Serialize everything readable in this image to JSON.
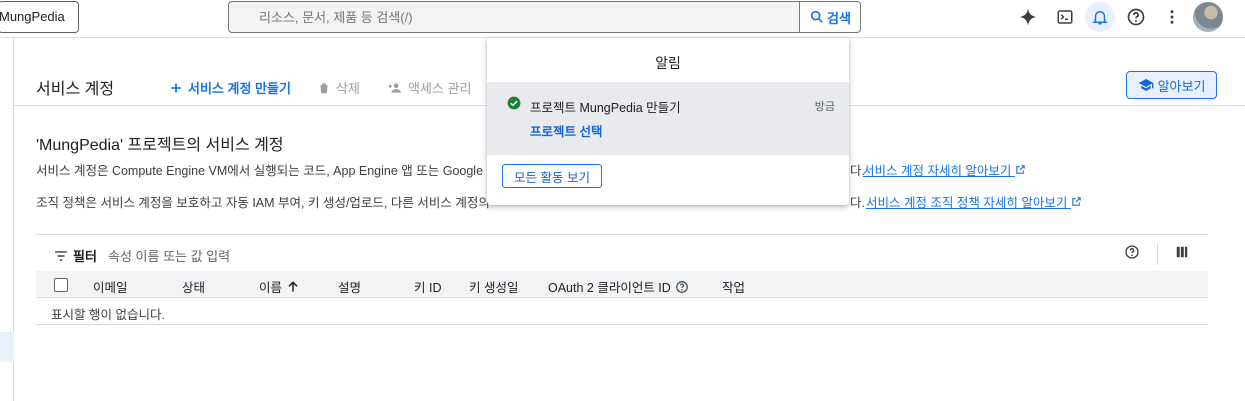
{
  "topbar": {
    "project_name": "MungPedia",
    "search_placeholder": "리소스, 문서, 제품 등 검색(/)",
    "search_button": "검색"
  },
  "header": {
    "title": "서비스 계정",
    "create_label": "서비스 계정 만들기",
    "delete_label": "삭제",
    "access_label": "액세스 관리",
    "learn_label": "알아보기"
  },
  "main": {
    "section_title": "'MungPedia' 프로젝트의 서비스 계정",
    "desc1": "서비스 계정은 Compute Engine VM에서 실행되는 코드, App Engine 앱 또는 Google 외",
    "desc1_tail": "다.",
    "desc1_link": "서비스 계정 자세히 알아보기",
    "desc2": "조직 정책은 서비스 계정을 보호하고 자동 IAM 부여, 키 생성/업로드, 다른 서비스 계정의",
    "desc2_tail": "다.",
    "desc2_link": "서비스 계정 조직 정책 자세히 알아보기"
  },
  "filter": {
    "label": "필터",
    "placeholder": "속성 이름 또는 값 입력"
  },
  "table": {
    "columns": [
      "이메일",
      "상태",
      "이름",
      "설명",
      "키 ID",
      "키 생성일",
      "OAuth 2 클라이언트 ID",
      "작업"
    ],
    "sorted_column": "이름",
    "sort_direction": "ascending",
    "empty_message": "표시할 행이 없습니다."
  },
  "notifications": {
    "title": "알림",
    "item_text": "프로젝트 MungPedia 만들기",
    "item_time": "방금",
    "item_link": "프로젝트 선택",
    "view_all": "모든 활동 보기"
  },
  "colors": {
    "accent": "#1a73e8",
    "success": "#188038"
  }
}
